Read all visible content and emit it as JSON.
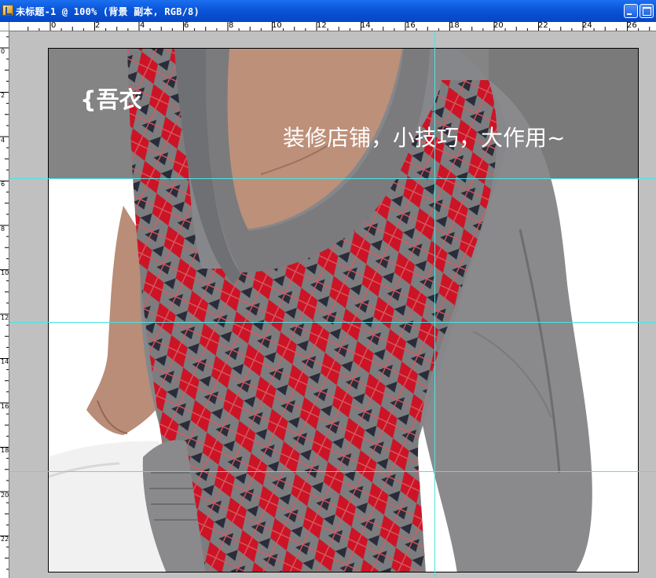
{
  "window": {
    "title": "未标题-1 @ 100% (背景 副本, RGB/8)",
    "minimize_icon": "minimize-icon",
    "maximize_icon": "maximize-icon"
  },
  "ruler": {
    "top_labels": [
      "0",
      "2",
      "4",
      "6",
      "8",
      "10",
      "12",
      "14",
      "16",
      "18",
      "20",
      "22",
      "24",
      "26"
    ],
    "left_labels": [
      "0",
      "2",
      "4",
      "6",
      "8",
      "10",
      "12",
      "14",
      "16",
      "18",
      "20",
      "22"
    ]
  },
  "canvas": {
    "banner_logo": "{吾衣",
    "banner_slogan": "装修店铺，小技巧，大作用~",
    "photo_description_icon": "model-photo-image"
  },
  "colors": {
    "titlebar": "#0a55d8",
    "guide": "#4de3e3",
    "banner": "#848484"
  }
}
